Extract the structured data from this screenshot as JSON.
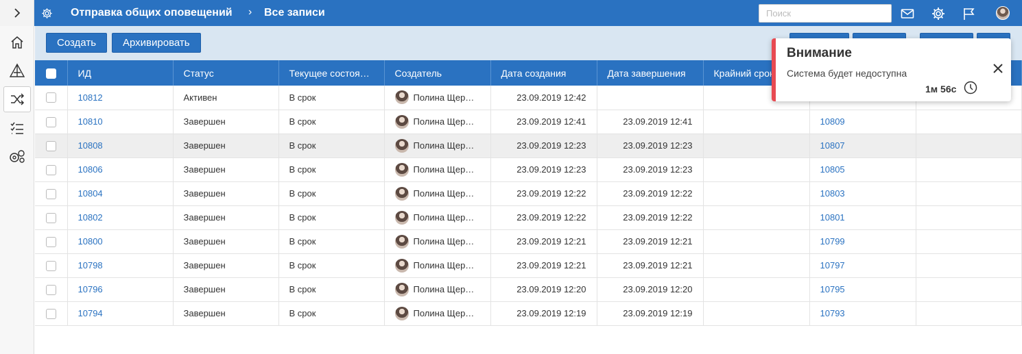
{
  "header": {
    "title": "Отправка общих оповещений",
    "separator": "›",
    "subtitle": "Все записи",
    "search_placeholder": "Поиск",
    "icons": [
      "gear-icon",
      "mail-icon",
      "settings-icon",
      "flag-icon",
      "avatar"
    ]
  },
  "sidebar": {
    "items": [
      "home-icon",
      "process-icon",
      "shuffle-icon",
      "checklist-icon",
      "admin-settings-icon"
    ],
    "active": "shuffle-icon"
  },
  "toolbar": {
    "create_label": "Создать",
    "archive_label": "Архивировать"
  },
  "table": {
    "columns": [
      "ИД",
      "Статус",
      "Текущее состоя…",
      "Создатель",
      "Дата создания",
      "Дата завершения",
      "Крайний срок"
    ],
    "rows": [
      {
        "id": "10812",
        "status": "Активен",
        "state": "В срок",
        "creator": "Полина Щер…",
        "created": "23.09.2019 12:42",
        "finished": "",
        "deadline": "",
        "link": ""
      },
      {
        "id": "10810",
        "status": "Завершен",
        "state": "В срок",
        "creator": "Полина Щер…",
        "created": "23.09.2019 12:41",
        "finished": "23.09.2019 12:41",
        "deadline": "",
        "link": "10809"
      },
      {
        "id": "10808",
        "status": "Завершен",
        "state": "В срок",
        "creator": "Полина Щер…",
        "created": "23.09.2019 12:23",
        "finished": "23.09.2019 12:23",
        "deadline": "",
        "link": "10807"
      },
      {
        "id": "10806",
        "status": "Завершен",
        "state": "В срок",
        "creator": "Полина Щер…",
        "created": "23.09.2019 12:23",
        "finished": "23.09.2019 12:23",
        "deadline": "",
        "link": "10805"
      },
      {
        "id": "10804",
        "status": "Завершен",
        "state": "В срок",
        "creator": "Полина Щер…",
        "created": "23.09.2019 12:22",
        "finished": "23.09.2019 12:22",
        "deadline": "",
        "link": "10803"
      },
      {
        "id": "10802",
        "status": "Завершен",
        "state": "В срок",
        "creator": "Полина Щер…",
        "created": "23.09.2019 12:22",
        "finished": "23.09.2019 12:22",
        "deadline": "",
        "link": "10801"
      },
      {
        "id": "10800",
        "status": "Завершен",
        "state": "В срок",
        "creator": "Полина Щер…",
        "created": "23.09.2019 12:21",
        "finished": "23.09.2019 12:21",
        "deadline": "",
        "link": "10799"
      },
      {
        "id": "10798",
        "status": "Завершен",
        "state": "В срок",
        "creator": "Полина Щер…",
        "created": "23.09.2019 12:21",
        "finished": "23.09.2019 12:21",
        "deadline": "",
        "link": "10797"
      },
      {
        "id": "10796",
        "status": "Завершен",
        "state": "В срок",
        "creator": "Полина Щер…",
        "created": "23.09.2019 12:20",
        "finished": "23.09.2019 12:20",
        "deadline": "",
        "link": "10795"
      },
      {
        "id": "10794",
        "status": "Завершен",
        "state": "В срок",
        "creator": "Полина Щер…",
        "created": "23.09.2019 12:19",
        "finished": "23.09.2019 12:19",
        "deadline": "",
        "link": "10793"
      }
    ],
    "highlighted_row": 2
  },
  "toast": {
    "title": "Внимание",
    "message": "Система будет недоступна",
    "time": "1м 56с",
    "accent_color": "#e84a52"
  },
  "colors": {
    "primary": "#2a72c1",
    "toolbar_bg": "#d9e6f2"
  }
}
